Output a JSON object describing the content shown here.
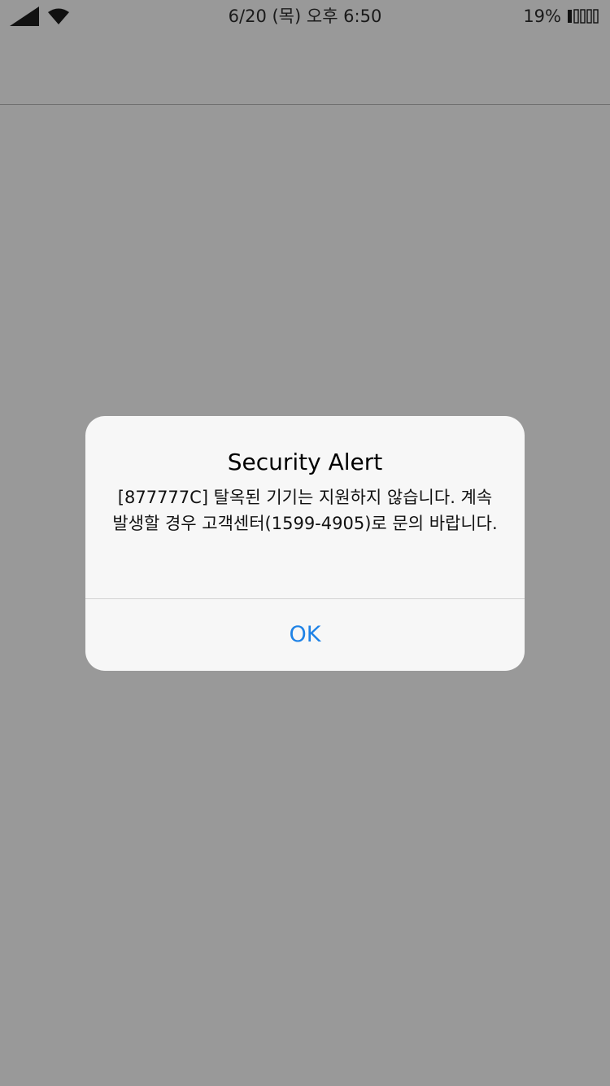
{
  "status_bar": {
    "time": "6/20 (목) 오후 6:50",
    "battery_percent": "19%",
    "icons": [
      "signal-icon",
      "wifi-icon",
      "battery-icon"
    ]
  },
  "alert": {
    "title": "Security Alert",
    "message": "[877777C] 탈옥된 기기는 지원하지 않습니다. 계속 발생할 경우 고객센터(1599-4905)로 문의 바랍니다.",
    "ok_label": "OK"
  },
  "colors": {
    "overlay_background": "#999999",
    "alert_background": "#f7f7f7",
    "accent": "#1e82e6"
  }
}
